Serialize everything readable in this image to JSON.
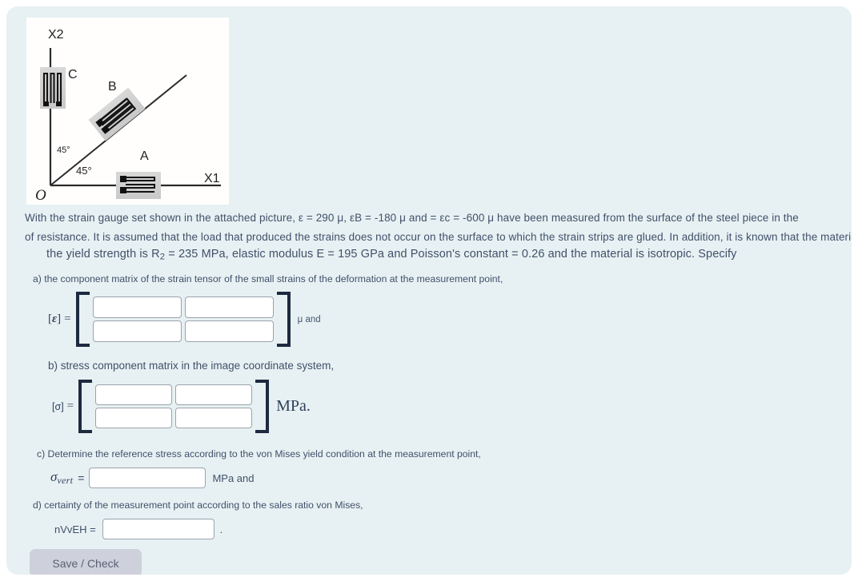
{
  "figure": {
    "alt": "strain-gauge-rosette-diagram",
    "axis_x_label": "X1",
    "axis_y_label": "X2",
    "origin_label": "O",
    "gauge_a_label": "A",
    "gauge_b_label": "B",
    "gauge_c_label": "C",
    "angle_upper_label": "45°",
    "angle_lower_label": "45°"
  },
  "prose": {
    "line1_a": "With the strain gauge set shown in the attached picture, ε = 290 μ, εB = -180 μ and = εc = -600 μ have been measured from the surface of the steel piece in the",
    "line2": "of resistance. It is assumed that the load that produced the strains does not occur on the surface to which the strain strips are glued. In addition, it is known that the material",
    "line3_pre": "the yield strength is R",
    "line3_sub": "2",
    "line3_post": " = 235 MPa, elastic modulus E = 195 GPa and Poisson's constant = 0.26 and the material is isotropic. Specify"
  },
  "questions": {
    "a": "a) the component matrix of the strain tensor of the small strains of the deformation at the measurement point,",
    "b": "b) stress component matrix in the image coordinate system,",
    "c": "c) Determine the reference stress according to the von Mises yield condition at the measurement point,",
    "d": "d) certainty of the measurement point according to the sales ratio von Mises,"
  },
  "matrix_a": {
    "label_open": "[",
    "label_symbol": "ε",
    "label_close": "]",
    "equals": "=",
    "cells": [
      "",
      "",
      "",
      ""
    ],
    "unit": "μ and"
  },
  "matrix_b": {
    "label": "[σ]",
    "equals": "=",
    "cells": [
      "",
      "",
      "",
      ""
    ],
    "unit": "MPa."
  },
  "answer_c": {
    "symbol": "σ",
    "subscript": "vert",
    "equals": "=",
    "value": "",
    "unit": "MPa and"
  },
  "answer_d": {
    "label": "nVvEH =",
    "value": "",
    "trailing": "."
  },
  "button": {
    "save_check_label": "Save / Check"
  },
  "colors": {
    "page_background": "#e7f1f3",
    "figure_background": "#fffefd",
    "text": "#41506a",
    "bracket": "#1d2a3f",
    "input_border": "#9aa3ad",
    "button_background": "#ced1dc",
    "button_text": "#5b5f72"
  }
}
